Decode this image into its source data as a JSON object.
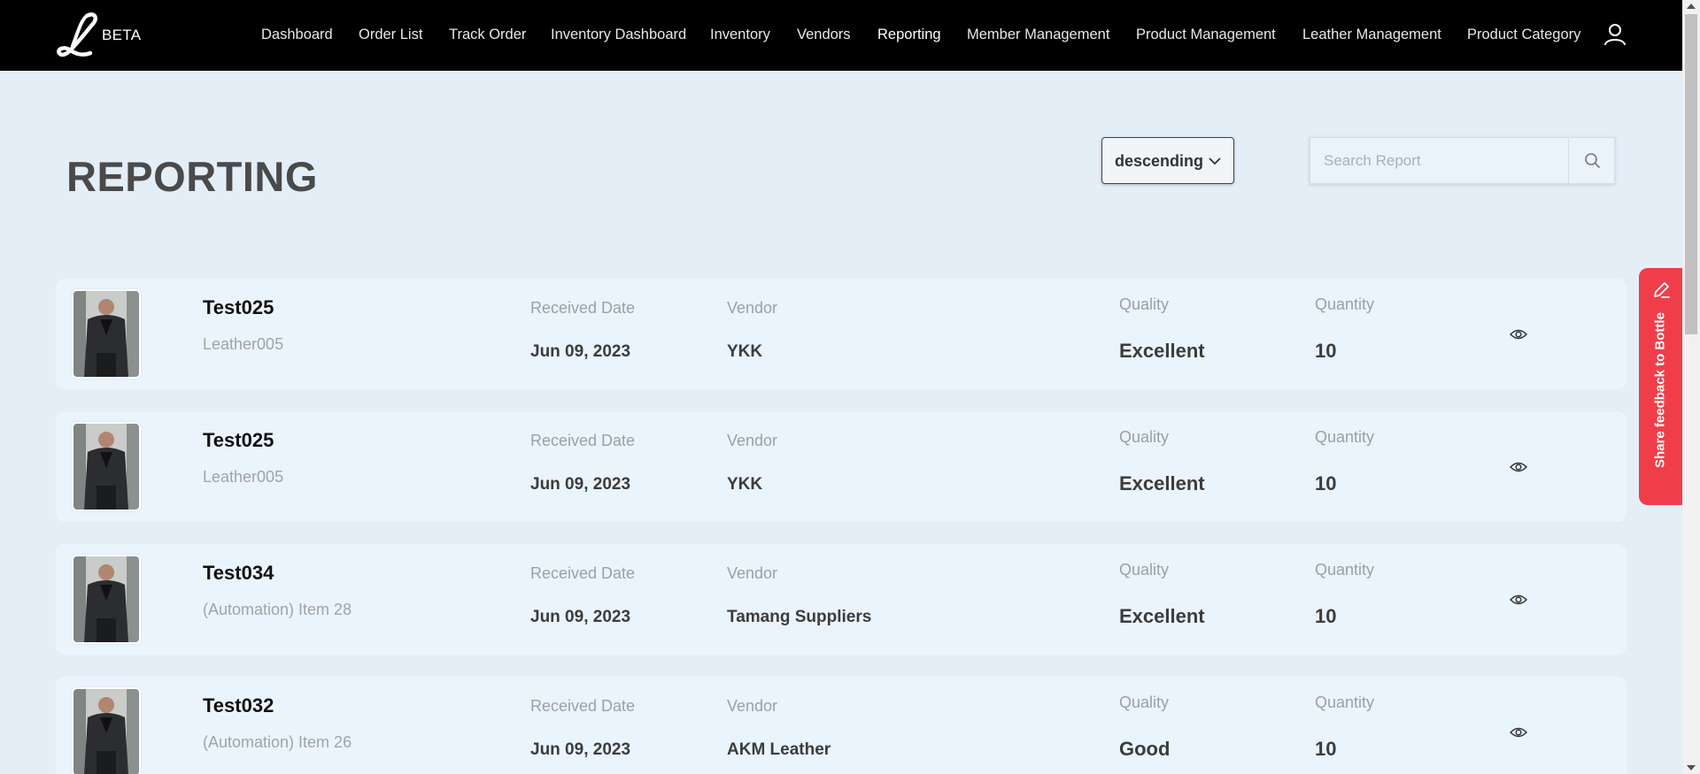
{
  "brand": {
    "badge": "BETA",
    "logo_icon": "script-L-logo"
  },
  "nav": {
    "items": [
      {
        "label": "Dashboard",
        "active": false
      },
      {
        "label": "Order List",
        "active": false
      },
      {
        "label": "Track Order",
        "active": false
      },
      {
        "label": "Inventory Dashboard",
        "active": false
      },
      {
        "label": "Inventory",
        "active": false
      },
      {
        "label": "Vendors",
        "active": false
      },
      {
        "label": "Reporting",
        "active": true
      },
      {
        "label": "Member Management",
        "active": false
      },
      {
        "label": "Product Management",
        "active": false
      },
      {
        "label": "Leather Management",
        "active": false
      },
      {
        "label": "Product Category",
        "active": false
      }
    ],
    "user_icon": "user-icon"
  },
  "page": {
    "title": "REPORTING",
    "sort": {
      "selected": "descending"
    },
    "search": {
      "placeholder": "Search Report",
      "value": ""
    }
  },
  "reports": [
    {
      "name": "Test025",
      "item": "Leather005",
      "received_label": "Received Date",
      "received": "Jun 09, 2023",
      "vendor_label": "Vendor",
      "vendor": "YKK",
      "quality_label": "Quality",
      "quality": "Excellent",
      "quantity_label": "Quantity",
      "quantity": "10"
    },
    {
      "name": "Test025",
      "item": "Leather005",
      "received_label": "Received Date",
      "received": "Jun 09, 2023",
      "vendor_label": "Vendor",
      "vendor": "YKK",
      "quality_label": "Quality",
      "quality": "Excellent",
      "quantity_label": "Quantity",
      "quantity": "10"
    },
    {
      "name": "Test034",
      "item": "(Automation) Item 28",
      "received_label": "Received Date",
      "received": "Jun 09, 2023",
      "vendor_label": "Vendor",
      "vendor": "Tamang Suppliers",
      "quality_label": "Quality",
      "quality": "Excellent",
      "quantity_label": "Quantity",
      "quantity": "10"
    },
    {
      "name": "Test032",
      "item": "(Automation) Item 26",
      "received_label": "Received Date",
      "received": "Jun 09, 2023",
      "vendor_label": "Vendor",
      "vendor": "AKM Leather",
      "quality_label": "Quality",
      "quality": "Good",
      "quantity_label": "Quantity",
      "quantity": "10"
    }
  ],
  "feedback": {
    "label": "Share feedback to Bottle",
    "color": "#ef3e49"
  },
  "colors": {
    "topbar": "#000000",
    "background": "#e4eef7",
    "card": "#eaf4fd"
  }
}
